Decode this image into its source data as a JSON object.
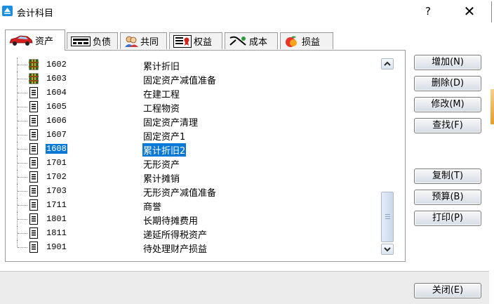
{
  "window": {
    "title": "会计科目",
    "help_label": "?",
    "close_label": "✕"
  },
  "tabs": [
    {
      "label": "资产",
      "icon": "car-icon",
      "active": true
    },
    {
      "label": "负债",
      "icon": "card-icon",
      "active": false
    },
    {
      "label": "共同",
      "icon": "people-icon",
      "active": false
    },
    {
      "label": "权益",
      "icon": "certificate-icon",
      "active": false
    },
    {
      "label": "成本",
      "icon": "tools-icon",
      "active": false
    },
    {
      "label": "损益",
      "icon": "apple-icon",
      "active": false
    }
  ],
  "accounts": [
    {
      "code": "1602",
      "name": "累计折旧",
      "icon": "ledger-icon"
    },
    {
      "code": "1603",
      "name": "固定资产减值准备",
      "icon": "ledger-icon"
    },
    {
      "code": "1604",
      "name": "在建工程",
      "icon": "document-icon"
    },
    {
      "code": "1605",
      "name": "工程物资",
      "icon": "document-icon"
    },
    {
      "code": "1606",
      "name": "固定资产清理",
      "icon": "document-icon"
    },
    {
      "code": "1607",
      "name": "固定资产1",
      "icon": "document-icon"
    },
    {
      "code": "1608",
      "name": "累计折旧2",
      "icon": "document-icon",
      "selected": true
    },
    {
      "code": "1701",
      "name": "无形资产",
      "icon": "document-icon"
    },
    {
      "code": "1702",
      "name": "累计摊销",
      "icon": "document-icon"
    },
    {
      "code": "1703",
      "name": "无形资产减值准备",
      "icon": "document-icon"
    },
    {
      "code": "1711",
      "name": "商誉",
      "icon": "document-icon"
    },
    {
      "code": "1801",
      "name": "长期待摊费用",
      "icon": "document-icon"
    },
    {
      "code": "1811",
      "name": "递延所得税资产",
      "icon": "document-icon"
    },
    {
      "code": "1901",
      "name": "待处理财产损益",
      "icon": "document-icon"
    }
  ],
  "buttons": {
    "add": "增加(N)",
    "delete": "删除(D)",
    "edit": "修改(M)",
    "find": "查找(F)",
    "copy": "复制(T)",
    "budget": "预算(B)",
    "print": "打印(P)",
    "close": "关闭(E)"
  },
  "colors": {
    "selection": "#0a78d7",
    "panel_border": "#9a9a9a"
  }
}
